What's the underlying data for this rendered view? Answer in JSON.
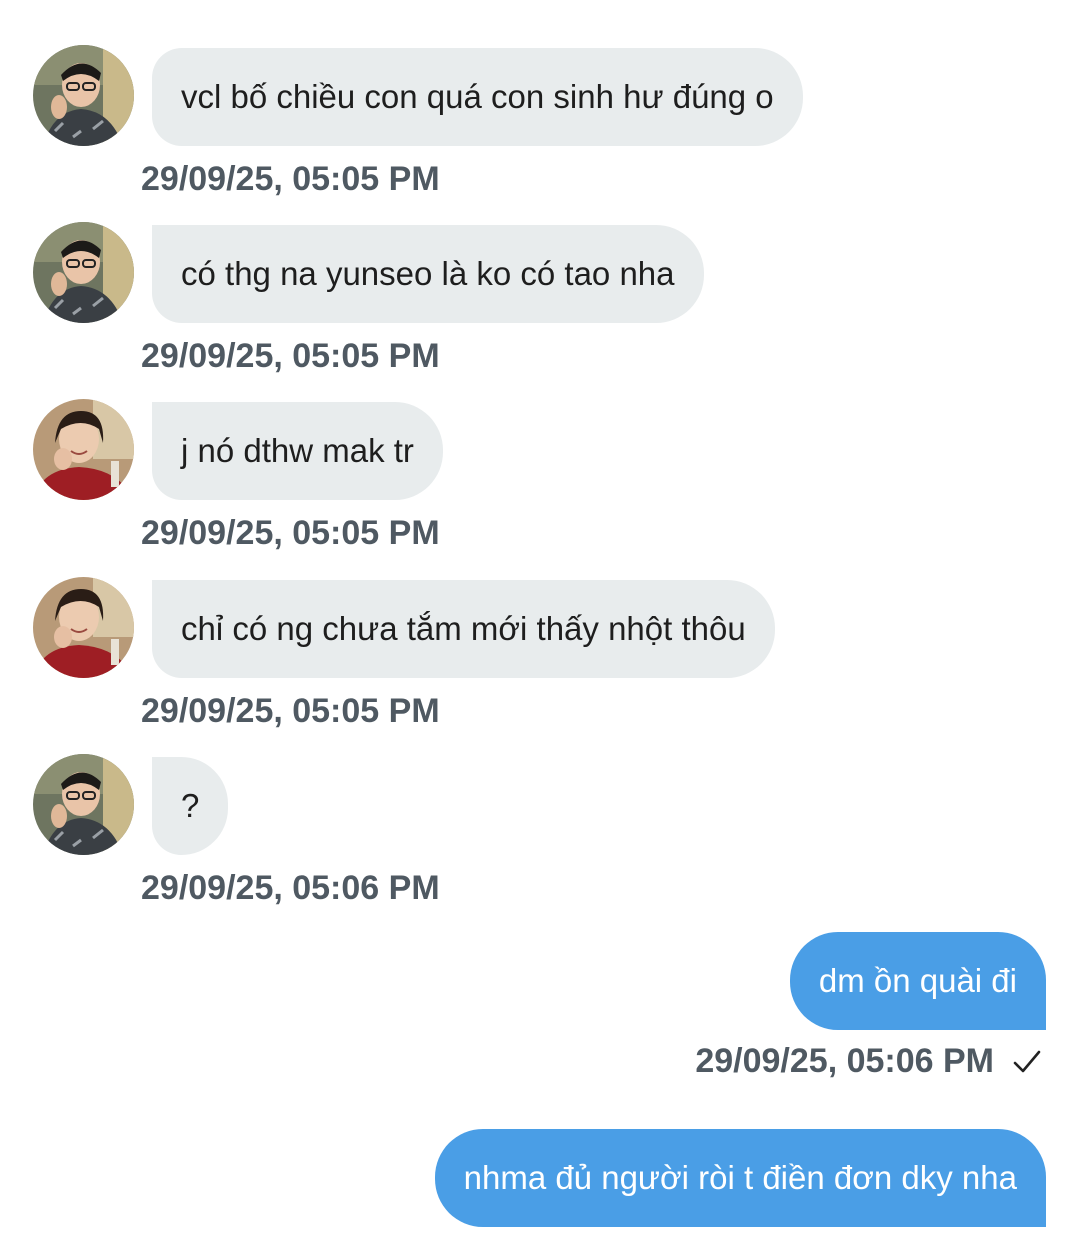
{
  "messages": [
    {
      "side": "in",
      "avatar": "male-user-avatar",
      "text": "vcl bố chiều con quá con sinh hư đúng o",
      "time": "29/09/25, 05:05 PM"
    },
    {
      "side": "in",
      "avatar": "male-user-avatar",
      "text": "có thg na yunseo là ko có tao nha",
      "time": "29/09/25, 05:05 PM"
    },
    {
      "side": "in",
      "avatar": "female-user-avatar",
      "text": "j nó dthw mak tr",
      "time": "29/09/25, 05:05 PM"
    },
    {
      "side": "in",
      "avatar": "female-user-avatar",
      "text": "chỉ có ng chưa tắm mới thấy nhột thôu",
      "time": "29/09/25, 05:05 PM"
    },
    {
      "side": "in",
      "avatar": "male-user-avatar",
      "text": "?",
      "time": "29/09/25, 05:06 PM"
    },
    {
      "side": "out",
      "text": "dm ồn quài đi",
      "time": "29/09/25, 05:06 PM",
      "status_icon": "check-icon"
    },
    {
      "side": "out",
      "text": "nhma đủ người ròi t điền đơn dky nha"
    }
  ],
  "colors": {
    "incoming_bubble": "#e8eced",
    "outgoing_bubble": "#4a9ee6",
    "timestamp": "#4f5962"
  }
}
